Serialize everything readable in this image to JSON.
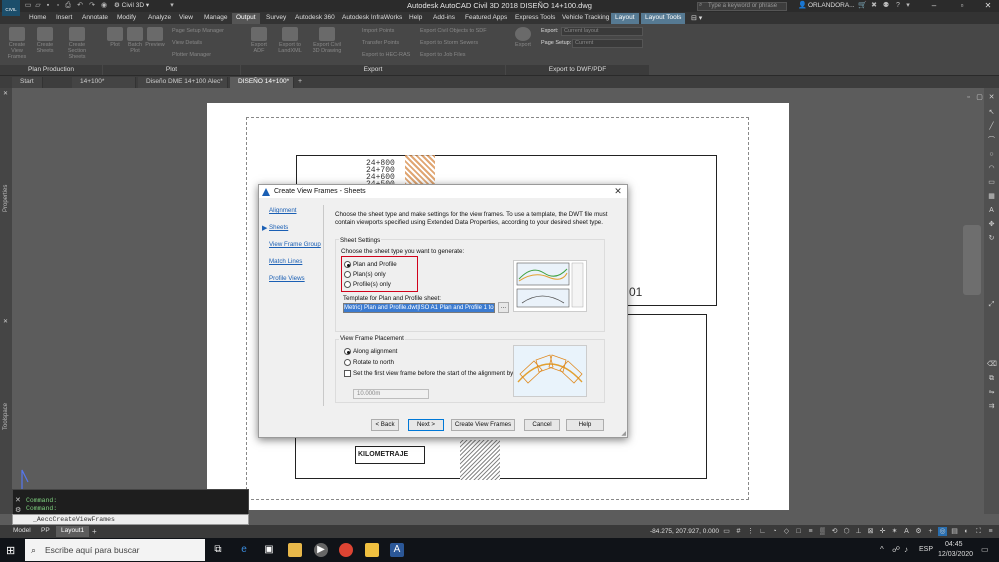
{
  "window": {
    "app_badge": "CIVIL",
    "workspace": "Civil 3D",
    "title": "Autodesk AutoCAD Civil 3D 2018    DISEÑO 14+100.dwg",
    "search_placeholder": "Type a keyword or phrase",
    "user": "ORLANDORA..."
  },
  "ribbon_tabs": [
    "Home",
    "Insert",
    "Annotate",
    "Modify",
    "Analyze",
    "View",
    "Manage",
    "Output",
    "Survey",
    "Autodesk 360",
    "Autodesk InfraWorks",
    "Help",
    "Add-ins",
    "Featured Apps",
    "Express Tools",
    "Vehicle Tracking",
    "Layout",
    "Layout Tools"
  ],
  "ribbon_active": "Output",
  "ribbon": {
    "plan_production": {
      "title": "Plan Production",
      "buttons": [
        "Create View Frames",
        "Create Sheets",
        "Create Section Sheets"
      ]
    },
    "plot": {
      "title": "Plot",
      "buttons": [
        "Plot",
        "Batch Plot",
        "Preview"
      ],
      "small": [
        "Page Setup Manager",
        "View Details",
        "Plotter Manager"
      ]
    },
    "export": {
      "title": "Export",
      "buttons": [
        "Export ADF",
        "Export to LandXML",
        "Export Civil 3D Drawing"
      ],
      "small": [
        "Import Points",
        "Transfer Points",
        "Export to HEC-RAS",
        "Export Civil Objects to SDF",
        "Export to Storm Sewers",
        "Export to Job Files"
      ]
    },
    "dwf": {
      "title": "Export to DWF/PDF",
      "button": "Export",
      "export_label": "Export:",
      "export_value": "Current layout",
      "page_setup_label": "Page Setup:",
      "page_setup_value": "Current"
    }
  },
  "doc_tabs": [
    "Start",
    "14+100*",
    "Diseño DME 14+100 Alec*",
    "DISEÑO 14+100*"
  ],
  "doc_tab_active": "DISEÑO 14+100*",
  "palettes": {
    "left_top": "Properties",
    "left_bottom": "Toolspace"
  },
  "drawing": {
    "stations": [
      "24+800",
      "24+700",
      "24+600",
      "24+500"
    ],
    "frame_label": "KILOMETRAJE",
    "tag": "01"
  },
  "command": {
    "lines": [
      "Command:",
      "Command:"
    ],
    "input": "_AeccCreateViewFrames"
  },
  "layout_tabs": [
    "Model",
    "PP",
    "Layout1"
  ],
  "layout_active": "Layout1",
  "coords": "-84.275, 207.927, 0.000",
  "dialog": {
    "title": "Create View Frames - Sheets",
    "nav": [
      "Alignment",
      "Sheets",
      "View Frame Group",
      "Match Lines",
      "Profile Views"
    ],
    "nav_current": "Sheets",
    "intro": "Choose the sheet type and make settings for the view frames. To use a template, the DWT file must contain viewports specified using Extended Data Properties, according to your desired sheet type.",
    "sheet_settings": {
      "title": "Sheet Settings",
      "prompt": "Choose the sheet type you want to generate:",
      "options": [
        "Plan and Profile",
        "Plan(s) only",
        "Profile(s) only"
      ],
      "selected": "Plan and Profile",
      "template_label": "Template for Plan and Profile sheet:",
      "template_value": "Metric) Plan and Profile.dwt|ISO A1 Plan and Profile 1 to 1000",
      "browse": "..."
    },
    "placement": {
      "title": "View Frame Placement",
      "options": [
        "Along alignment",
        "Rotate to north"
      ],
      "selected": "Along alignment",
      "checkbox_label": "Set the first view frame before the start of the alignment by:",
      "checkbox_checked": false,
      "offset_value": "10.000m"
    },
    "buttons": {
      "back": "< Back",
      "next": "Next >",
      "create": "Create View Frames",
      "cancel": "Cancel",
      "help": "Help"
    }
  },
  "taskbar": {
    "search": "Escribe aquí para buscar",
    "lang": "ESP",
    "time": "04:45",
    "date": "12/03/2020"
  },
  "colors": {
    "highlight_box": "#d0021b",
    "link": "#1a5fb4",
    "ctx_tab": "#567a93"
  }
}
